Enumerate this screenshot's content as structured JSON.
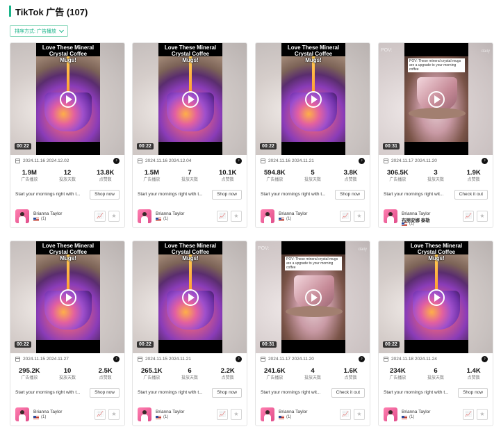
{
  "header": {
    "title": "TikTok 广告 (107)"
  },
  "sort": {
    "label": "排序方式: 广告播放"
  },
  "labels": {
    "impressions": "广告播放",
    "days": "投放天数",
    "likes": "点赞数"
  },
  "overlay_text": "Love These Mineral Crystal Coffee Mugs!",
  "mug_caption": "POV: These mineral crystal mugs are a upgrade to your morning coffee",
  "pov_left": "POV:",
  "pov_right": "daily",
  "cards": [
    {
      "thumb": "crystal",
      "duration": "00:22",
      "dates": "2024.11.16 2024.12.02",
      "impressions": "1.9M",
      "days": "12",
      "likes": "13.8K",
      "desc": "Start your mornings right with t...",
      "cta": "Shop now",
      "user": "Brianna Taylor",
      "user2": "",
      "region": "(1)"
    },
    {
      "thumb": "crystal",
      "duration": "00:22",
      "dates": "2024.11.16 2024.12.04",
      "impressions": "1.5M",
      "days": "7",
      "likes": "10.1K",
      "desc": "Start your mornings right with t...",
      "cta": "Shop now",
      "user": "Brianna Taylor",
      "user2": "",
      "region": "(1)"
    },
    {
      "thumb": "crystal",
      "duration": "00:22",
      "dates": "2024.11.16 2024.11.21",
      "impressions": "594.8K",
      "days": "5",
      "likes": "3.8K",
      "desc": "Start your mornings right with t...",
      "cta": "Shop now",
      "user": "Brianna Taylor",
      "user2": "",
      "region": "(1)"
    },
    {
      "thumb": "mug",
      "duration": "00:31",
      "dates": "2024.11.17 2024.11.20",
      "impressions": "306.5K",
      "days": "3",
      "likes": "1.9K",
      "desc": "Start your mornings right wit...",
      "cta": "Check it out",
      "user": "Brianna Taylor",
      "user2": "布丽安娜 泰勒",
      "region": "(1)"
    },
    {
      "thumb": "crystal",
      "duration": "00:22",
      "dates": "2024.11.15 2024.11.27",
      "impressions": "295.2K",
      "days": "10",
      "likes": "2.5K",
      "desc": "Start your mornings right with t...",
      "cta": "Shop now",
      "user": "Brianna Taylor",
      "user2": "",
      "region": "(1)"
    },
    {
      "thumb": "crystal",
      "duration": "00:22",
      "dates": "2024.11.15 2024.11.21",
      "impressions": "265.1K",
      "days": "6",
      "likes": "2.2K",
      "desc": "Start your mornings right with t...",
      "cta": "Shop now",
      "user": "Brianna Taylor",
      "user2": "",
      "region": "(1)"
    },
    {
      "thumb": "mug",
      "duration": "00:31",
      "dates": "2024.11.17 2024.11.20",
      "impressions": "241.6K",
      "days": "4",
      "likes": "1.6K",
      "desc": "Start your mornings right wit...",
      "cta": "Check it out",
      "user": "Brianna Taylor",
      "user2": "",
      "region": "(1)"
    },
    {
      "thumb": "crystal",
      "duration": "00:22",
      "dates": "2024.11.18 2024.11.24",
      "impressions": "234K",
      "days": "6",
      "likes": "1.4K",
      "desc": "Start your mornings right with t...",
      "cta": "Shop now",
      "user": "Brianna Taylor",
      "user2": "",
      "region": "(1)"
    }
  ],
  "icons": {
    "play": "play-icon",
    "calendar": "calendar-icon",
    "tiktok": "tiktok-icon",
    "trend": "trend-chart-icon",
    "star": "star-icon",
    "flag": "us-flag-icon"
  },
  "colors": {
    "accent": "#19b489"
  }
}
